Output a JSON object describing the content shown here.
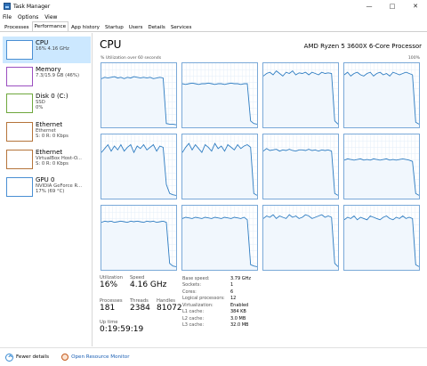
{
  "window": {
    "title": "Task Manager",
    "controls": {
      "minimize": "—",
      "maximize": "□",
      "close": "✕"
    }
  },
  "menu": [
    "File",
    "Options",
    "View"
  ],
  "tabs": [
    {
      "label": "Processes",
      "active": false
    },
    {
      "label": "Performance",
      "active": true
    },
    {
      "label": "App history",
      "active": false
    },
    {
      "label": "Startup",
      "active": false
    },
    {
      "label": "Users",
      "active": false
    },
    {
      "label": "Details",
      "active": false
    },
    {
      "label": "Services",
      "active": false
    }
  ],
  "sidebar": [
    {
      "name": "CPU",
      "sub1": "16% 4.16 GHz",
      "sub2": "",
      "sub3": "",
      "color": "#4a8fd3",
      "selected": true
    },
    {
      "name": "Memory",
      "sub1": "7.3/15.9 GB (46%)",
      "sub2": "",
      "sub3": "",
      "color": "#9b4fc0",
      "selected": false
    },
    {
      "name": "Disk 0 (C:)",
      "sub1": "SSD",
      "sub2": "0%",
      "sub3": "",
      "color": "#6fa83d",
      "selected": false
    },
    {
      "name": "Ethernet",
      "sub1": "Ethernet",
      "sub2": "S: 0 R: 0 Kbps",
      "sub3": "",
      "color": "#b5743a",
      "selected": false
    },
    {
      "name": "Ethernet",
      "sub1": "VirtualBox Host-O...",
      "sub2": "S: 0 R: 0 Kbps",
      "sub3": "",
      "color": "#b5743a",
      "selected": false
    },
    {
      "name": "GPU 0",
      "sub1": "NVIDIA GeForce R...",
      "sub2": "17% (69 °C)",
      "sub3": "",
      "color": "#4a8fd3",
      "selected": false
    }
  ],
  "header": {
    "title": "CPU",
    "model": "AMD Ryzen 5 3600X 6-Core Processor",
    "axis_label": "% Utilization over 60 seconds",
    "axis_max": "100%"
  },
  "stats": {
    "utilization_label": "Utilization",
    "utilization": "16%",
    "speed_label": "Speed",
    "speed": "4.16 GHz",
    "processes_label": "Processes",
    "processes": "181",
    "threads_label": "Threads",
    "threads": "2384",
    "handles_label": "Handles",
    "handles": "81072",
    "uptime_label": "Up time",
    "uptime": "0:19:59:19"
  },
  "details": [
    {
      "key": "Base speed:",
      "value": "3.79 GHz"
    },
    {
      "key": "Sockets:",
      "value": "1"
    },
    {
      "key": "Cores:",
      "value": "6"
    },
    {
      "key": "Logical processors:",
      "value": "12"
    },
    {
      "key": "Virtualization:",
      "value": "Enabled"
    },
    {
      "key": "L1 cache:",
      "value": "384 KB"
    },
    {
      "key": "L2 cache:",
      "value": "3.0 MB"
    },
    {
      "key": "L3 cache:",
      "value": "32.0 MB"
    }
  ],
  "footer": {
    "fewer_details": "Fewer details",
    "open_resource_monitor": "Open Resource Monitor"
  },
  "colors": {
    "graph_line": "#2f7dc2",
    "graph_border": "#7aa9d8",
    "graph_grid": "#e3eef9",
    "selected_bg": "#cce8ff",
    "link": "#1a5fb4"
  },
  "core_utilization_percent": [
    [
      76,
      78,
      77,
      78,
      79,
      77,
      78,
      76,
      78,
      77,
      79,
      78,
      77,
      78,
      77,
      78,
      76,
      77,
      78,
      77,
      6,
      5,
      5,
      4
    ],
    [
      68,
      67,
      68,
      69,
      68,
      67,
      68,
      68,
      69,
      68,
      67,
      68,
      68,
      67,
      68,
      69,
      68,
      68,
      67,
      68,
      68,
      10,
      6,
      5
    ],
    [
      80,
      84,
      86,
      82,
      88,
      84,
      80,
      86,
      84,
      88,
      82,
      85,
      84,
      86,
      82,
      86,
      84,
      82,
      86,
      84,
      85,
      84,
      10,
      5
    ],
    [
      82,
      86,
      80,
      84,
      86,
      82,
      80,
      84,
      86,
      80,
      84,
      86,
      82,
      84,
      80,
      86,
      84,
      82,
      84,
      86,
      84,
      82,
      8,
      5
    ],
    [
      72,
      78,
      84,
      74,
      82,
      76,
      84,
      74,
      80,
      84,
      72,
      82,
      78,
      84,
      76,
      80,
      84,
      74,
      82,
      80,
      22,
      8,
      6,
      5
    ],
    [
      72,
      80,
      86,
      76,
      84,
      78,
      72,
      84,
      80,
      74,
      86,
      78,
      82,
      74,
      84,
      80,
      76,
      84,
      78,
      82,
      84,
      80,
      8,
      5
    ],
    [
      74,
      78,
      75,
      76,
      77,
      74,
      76,
      75,
      77,
      75,
      74,
      76,
      76,
      75,
      77,
      75,
      76,
      74,
      76,
      75,
      76,
      74,
      8,
      5
    ],
    [
      60,
      62,
      61,
      60,
      61,
      62,
      60,
      61,
      60,
      62,
      61,
      60,
      61,
      62,
      60,
      61,
      60,
      61,
      62,
      61,
      60,
      58,
      8,
      5
    ],
    [
      74,
      76,
      75,
      76,
      74,
      75,
      76,
      75,
      74,
      76,
      75,
      76,
      75,
      74,
      76,
      75,
      76,
      74,
      75,
      76,
      74,
      10,
      6,
      5
    ],
    [
      80,
      82,
      81,
      80,
      82,
      81,
      80,
      82,
      81,
      80,
      82,
      81,
      80,
      82,
      81,
      80,
      82,
      81,
      80,
      82,
      78,
      8,
      6,
      5
    ],
    [
      80,
      84,
      82,
      86,
      80,
      84,
      82,
      80,
      86,
      82,
      84,
      80,
      82,
      86,
      84,
      80,
      82,
      84,
      86,
      82,
      84,
      82,
      10,
      5
    ],
    [
      78,
      82,
      80,
      84,
      78,
      82,
      80,
      78,
      84,
      82,
      80,
      78,
      82,
      84,
      80,
      78,
      82,
      80,
      84,
      80,
      82,
      80,
      8,
      5
    ]
  ]
}
